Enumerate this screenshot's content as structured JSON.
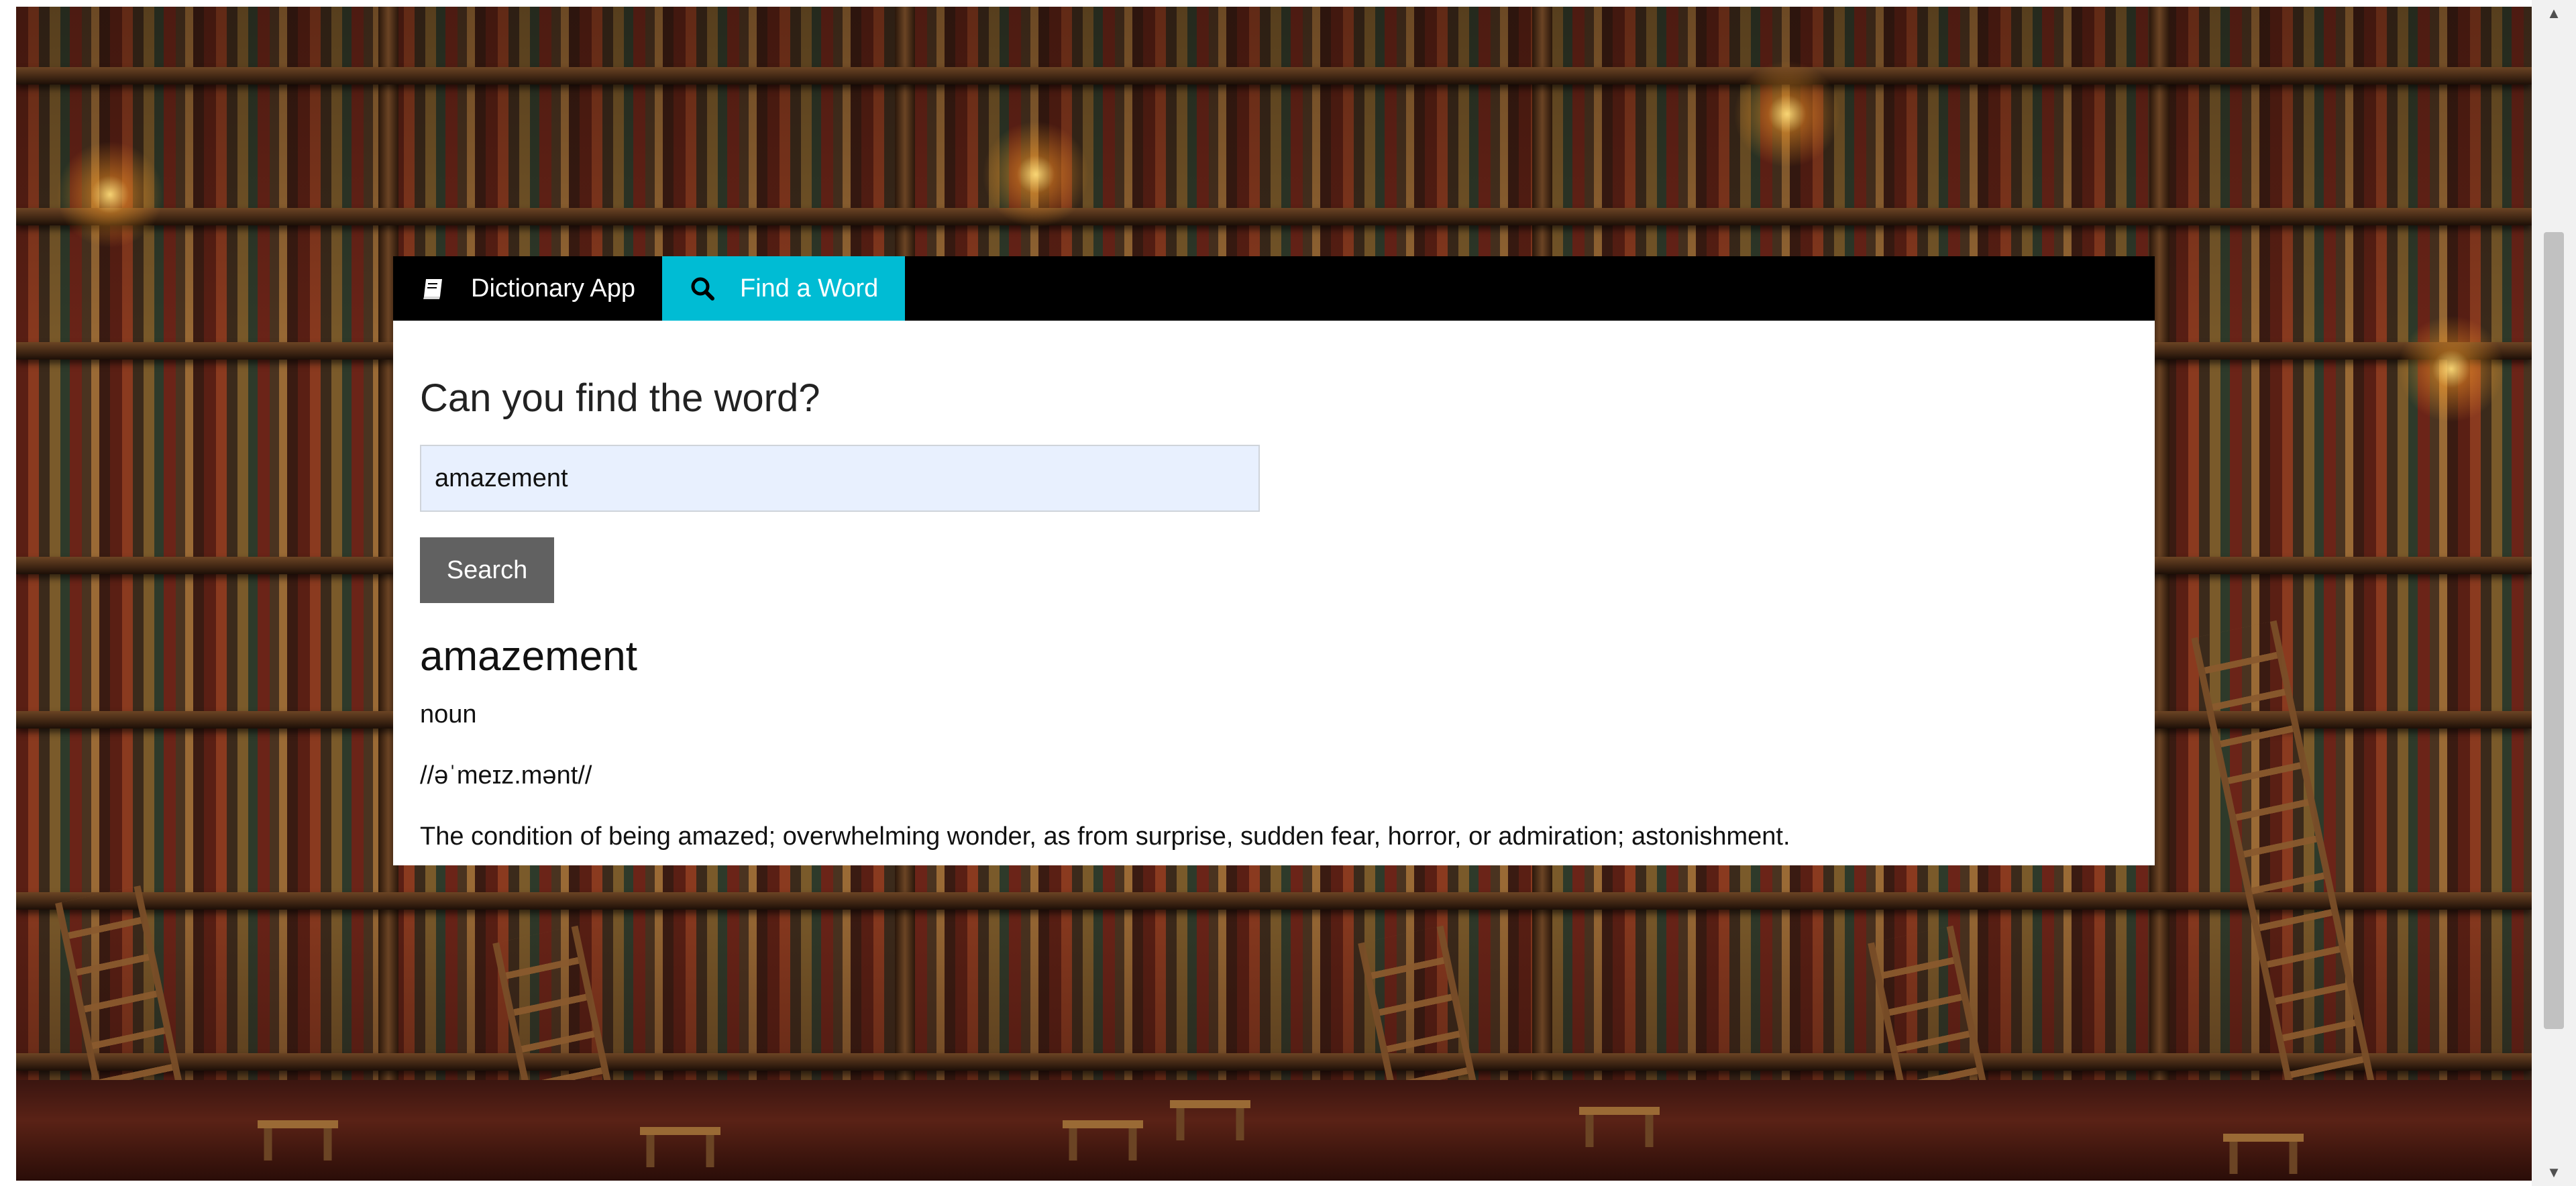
{
  "navbar": {
    "brand_label": "Dictionary App",
    "brand_icon": "book-icon",
    "find_label": "Find a Word",
    "find_icon": "search-icon",
    "active_color": "#00bcd4"
  },
  "search": {
    "heading": "Can you find the word?",
    "value": "amazement",
    "button_label": "Search"
  },
  "result": {
    "word": "amazement",
    "part_of_speech": "noun",
    "pronunciation": "//əˈmeɪz.mənt//",
    "definition": "The condition of being amazed; overwhelming wonder, as from surprise, sudden fear, horror, or admiration; astonishment."
  }
}
